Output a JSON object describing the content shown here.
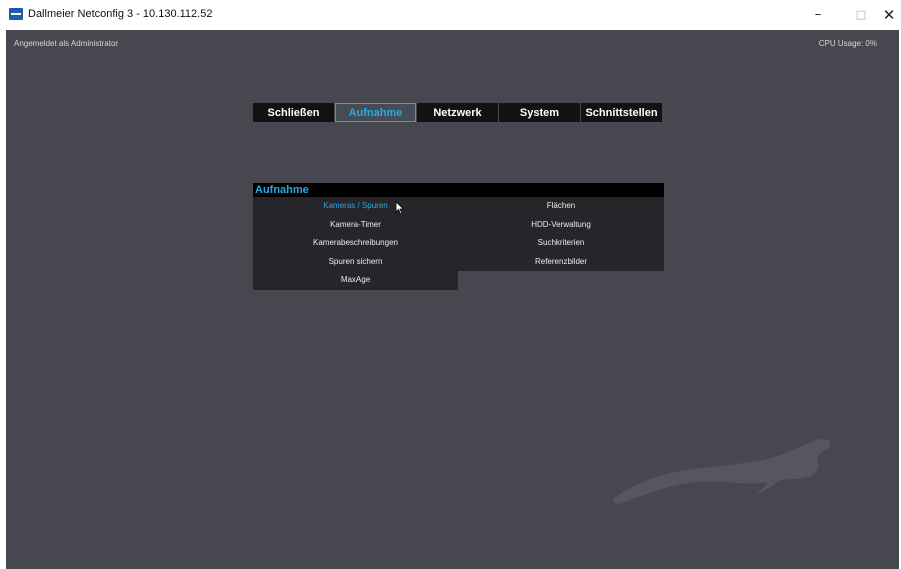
{
  "window": {
    "title": "Dallmeier Netconfig 3 - 10.130.112.52",
    "controls": {
      "minimize": "–",
      "maximize": "□",
      "close": "✕"
    }
  },
  "status": {
    "logged_in": "Angemeldet als Administrator",
    "cpu_usage": "CPU Usage: 0%"
  },
  "tabs": [
    {
      "label": "Schließen",
      "active": false
    },
    {
      "label": "Aufnahme",
      "active": true
    },
    {
      "label": "Netzwerk",
      "active": false
    },
    {
      "label": "System",
      "active": false
    },
    {
      "label": "Schnittstellen",
      "active": false
    }
  ],
  "panel": {
    "title": "Aufnahme",
    "left_items": [
      "Kameras / Spuren",
      "Kamera-Timer",
      "Kamerabeschreibungen",
      "Spuren sichern",
      "MaxAge"
    ],
    "right_items": [
      "Flächen",
      "HDD-Verwaltung",
      "Suchkriterien",
      "Referenzbilder"
    ],
    "active_item": "Kameras / Spuren"
  },
  "icons": {
    "app": "dallmeier-app-icon",
    "cursor": "mouse-pointer-icon",
    "logo": "panther-logo-icon"
  },
  "colors": {
    "background": "#47474f",
    "accent": "#29a8e6",
    "tab_bg": "#121212",
    "panel_bg": "#26262a"
  }
}
